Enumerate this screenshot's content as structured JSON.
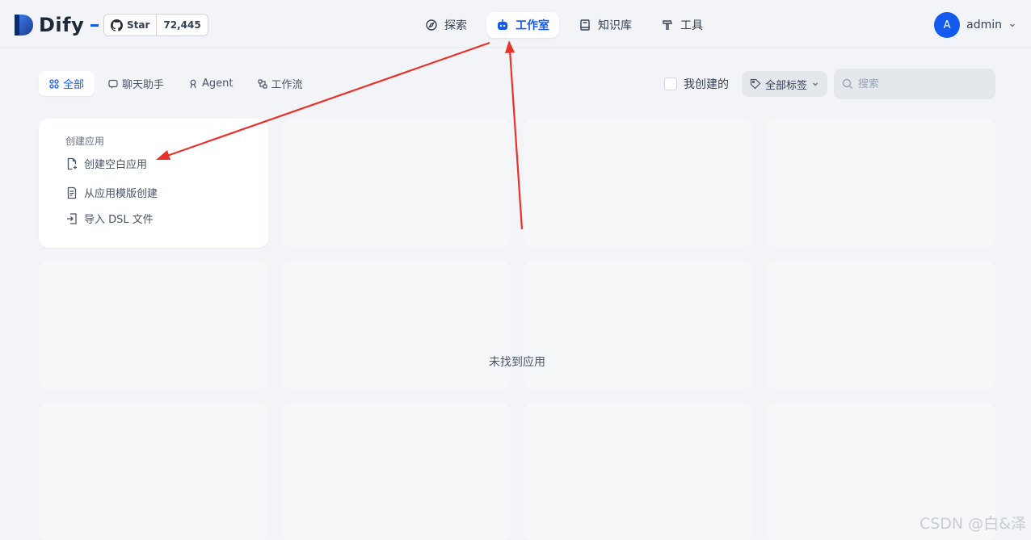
{
  "brand": {
    "name": "Dify",
    "accent": "#155aef"
  },
  "github": {
    "label": "Star",
    "count": "72,445"
  },
  "nav": [
    {
      "label": "探索",
      "icon": "compass-icon",
      "active": false
    },
    {
      "label": "工作室",
      "icon": "robot-icon",
      "active": true
    },
    {
      "label": "知识库",
      "icon": "book-icon",
      "active": false
    },
    {
      "label": "工具",
      "icon": "hammer-icon",
      "active": false
    }
  ],
  "user": {
    "avatar_letter": "A",
    "name": "admin"
  },
  "tabs": [
    {
      "label": "全部",
      "icon": "grid-icon",
      "active": true
    },
    {
      "label": "聊天助手",
      "icon": "chat-icon",
      "active": false
    },
    {
      "label": "Agent",
      "icon": "agent-icon",
      "active": false
    },
    {
      "label": "工作流",
      "icon": "workflow-icon",
      "active": false
    }
  ],
  "filters": {
    "mine_label": "我创建的",
    "tag_label": "全部标签",
    "search_placeholder": "搜索"
  },
  "create_card": {
    "title": "创建应用",
    "items": [
      {
        "label": "创建空白应用",
        "icon": "new-file-icon"
      },
      {
        "label": "从应用模版创建",
        "icon": "template-icon"
      },
      {
        "label": "导入 DSL 文件",
        "icon": "import-icon"
      }
    ]
  },
  "empty_text": "未找到应用",
  "watermark": "CSDN @白&泽",
  "annotation_color": "#e8312a"
}
